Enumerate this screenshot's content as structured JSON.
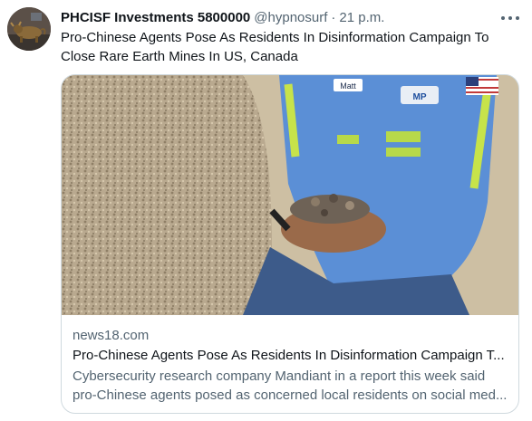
{
  "tweet": {
    "author": {
      "display_name": "PHCISF Investments 5800000",
      "handle": "@hypnosurf",
      "avatar_icon": "bull-statue-avatar"
    },
    "separator": "·",
    "timestamp": "21 p.m.",
    "text": "Pro-Chinese Agents Pose As Residents In Disinformation Campaign To Close Rare Earth Mines In US, Canada",
    "more_icon": "more-horizontal-icon"
  },
  "card": {
    "image": {
      "name_badge": "Matt",
      "logo_text": "MP"
    },
    "domain": "news18.com",
    "title": "Pro-Chinese Agents Pose As Residents In Disinformation Campaign T...",
    "description_lines": [
      "Cybersecurity research company Mandiant in a report this week said",
      "pro-Chinese agents posed as concerned local residents on social med..."
    ]
  },
  "colors": {
    "text_primary": "#0f1419",
    "text_secondary": "#536471",
    "border": "#cfd9de",
    "background": "#ffffff"
  }
}
